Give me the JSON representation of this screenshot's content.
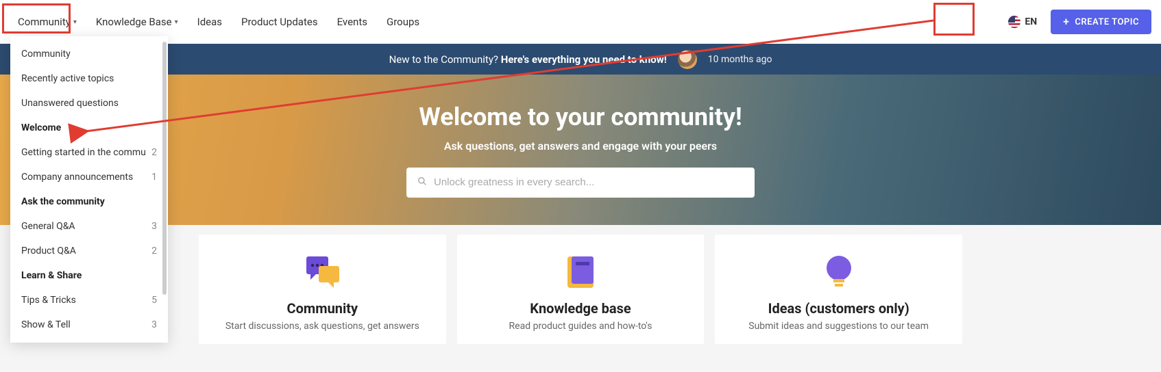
{
  "nav": {
    "items": [
      {
        "label": "Community",
        "dropdown": true
      },
      {
        "label": "Knowledge Base",
        "dropdown": true
      },
      {
        "label": "Ideas",
        "dropdown": false
      },
      {
        "label": "Product Updates",
        "dropdown": false
      },
      {
        "label": "Events",
        "dropdown": false
      },
      {
        "label": "Groups",
        "dropdown": false
      }
    ],
    "lang": "EN",
    "create": "CREATE TOPIC"
  },
  "dropdown": {
    "top": [
      {
        "label": "Community"
      },
      {
        "label": "Recently active topics"
      },
      {
        "label": "Unanswered questions"
      }
    ],
    "sections": [
      {
        "header": "Welcome",
        "items": [
          {
            "label": "Getting started in the commu",
            "count": 2
          },
          {
            "label": "Company announcements",
            "count": 1
          }
        ]
      },
      {
        "header": "Ask the community",
        "items": [
          {
            "label": "General Q&A",
            "count": 3
          },
          {
            "label": "Product Q&A",
            "count": 2
          }
        ]
      },
      {
        "header": "Learn & Share",
        "items": [
          {
            "label": "Tips & Tricks",
            "count": 5
          },
          {
            "label": "Show & Tell",
            "count": 3
          }
        ]
      }
    ]
  },
  "notice": {
    "prefix": "New to the Community? ",
    "bold": "Here's everything you need to know!",
    "time": "10 months ago"
  },
  "hero": {
    "title": "Welcome to your community!",
    "subtitle": "Ask questions, get answers and engage with your peers",
    "search_placeholder": "Unlock greatness in every search..."
  },
  "cards": [
    {
      "icon": "chat",
      "title": "Community",
      "sub": "Start discussions, ask questions, get answers"
    },
    {
      "icon": "book",
      "title": "Knowledge base",
      "sub": "Read product guides and how-to's"
    },
    {
      "icon": "bulb",
      "title": "Ideas (customers only)",
      "sub": "Submit ideas and suggestions to our team"
    }
  ]
}
